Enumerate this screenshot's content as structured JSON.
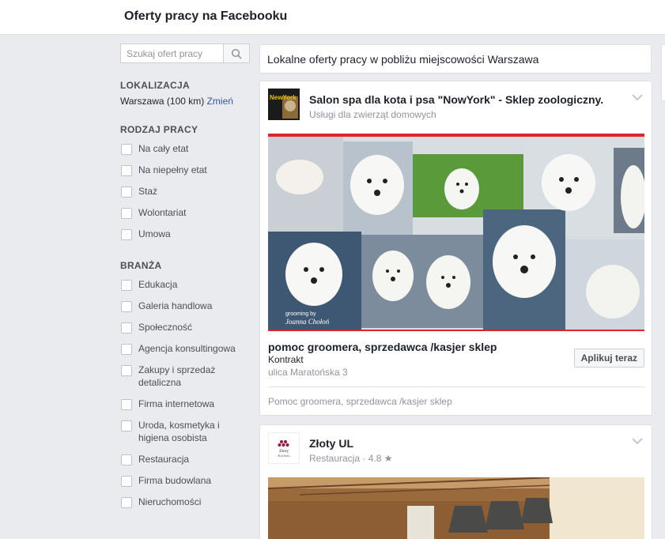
{
  "header": {
    "title": "Oferty pracy na Facebooku"
  },
  "search": {
    "placeholder": "Szukaj ofert pracy"
  },
  "sidebar": {
    "location": {
      "heading": "LOKALIZACJA",
      "value": "Warszawa (100 km)",
      "change_link": "Zmień"
    },
    "job_type": {
      "heading": "RODZAJ PRACY",
      "items": [
        "Na cały etat",
        "Na niepełny etat",
        "Staż",
        "Wolontariat",
        "Umowa"
      ]
    },
    "industry": {
      "heading": "BRANŻA",
      "items": [
        "Edukacja",
        "Galeria handlowa",
        "Społeczność",
        "Agencja konsultingowa",
        "Zakupy i sprzedaż detaliczna",
        "Firma internetowa",
        "Uroda, kosmetyka i higiena osobista",
        "Restauracja",
        "Firma budowlana",
        "Nieruchomości"
      ]
    }
  },
  "main": {
    "heading": "Lokalne oferty pracy w pobliżu miejscowości Warszawa",
    "cards": [
      {
        "company": "Salon spa dla kota i psa \"NowYork\" - Sklep zoologiczny.",
        "category": "Usługi dla zwierząt domowych",
        "avatar_text": "NewYork",
        "photo_caption_1": "grooming by",
        "photo_caption_2": "Joanna Chołoń",
        "job_title": "pomoc groomera, sprzedawca /kasjer sklep",
        "job_type": "Kontrakt",
        "address": "ulica Maratońska 3",
        "apply_label": "Aplikuj teraz",
        "description": "Pomoc groomera, sprzedawca /kasjer sklep"
      },
      {
        "company": "Złoty UL",
        "category": "Restauracja",
        "rating": "4.8",
        "avatar_text_1": "Złoty",
        "avatar_text_2": "Kuchnia"
      }
    ]
  },
  "colors": {
    "link": "#365899",
    "accent_red": "#e0242c",
    "page_bg": "#e9ebee"
  }
}
